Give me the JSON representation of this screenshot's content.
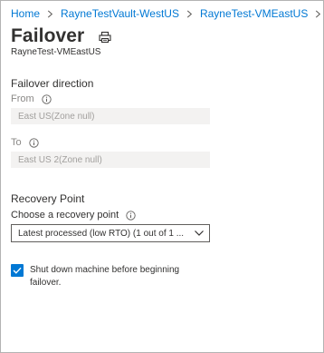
{
  "breadcrumb": {
    "items": [
      {
        "label": "Home"
      },
      {
        "label": "RayneTestVault-WestUS"
      },
      {
        "label": "RayneTest-VMEastUS"
      }
    ]
  },
  "header": {
    "title": "Failover",
    "subtitle": "RayneTest-VMEastUS",
    "print_icon": "print-icon"
  },
  "failover_direction": {
    "section_label": "Failover direction",
    "from_label": "From",
    "from_value": "East US(Zone null)",
    "to_label": "To",
    "to_value": "East US 2(Zone null)"
  },
  "recovery_point": {
    "section_label": "Recovery Point",
    "choose_label": "Choose a recovery point",
    "selected_value": "Latest processed (low RTO) (1 out of 1 ..."
  },
  "shutdown": {
    "checked": true,
    "label": "Shut down machine before beginning failover."
  },
  "colors": {
    "accent": "#0078d4",
    "disabled_bg": "#f3f2f1",
    "text": "#323130"
  }
}
